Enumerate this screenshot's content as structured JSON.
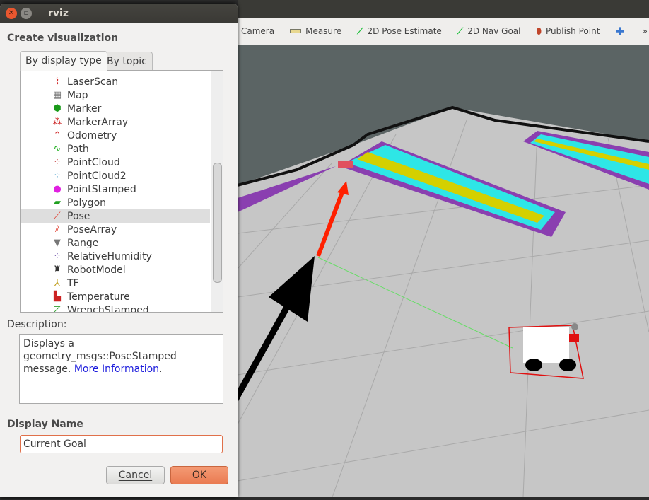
{
  "window": {
    "title": "rviz"
  },
  "toolbar": {
    "items": [
      {
        "label": "Camera",
        "icon": "camera-icon"
      },
      {
        "label": "Measure",
        "icon": "ruler-icon"
      },
      {
        "label": "2D Pose Estimate",
        "icon": "green-arrow-icon"
      },
      {
        "label": "2D Nav Goal",
        "icon": "green-arrow-icon"
      },
      {
        "label": "Publish Point",
        "icon": "map-pin-icon"
      },
      {
        "label": "",
        "icon": "plus-icon"
      }
    ],
    "overflow": "»"
  },
  "dialog": {
    "heading": "Create visualization",
    "tabs": [
      {
        "label": "By display type",
        "active": true
      },
      {
        "label": "By topic",
        "active": false
      }
    ],
    "items": [
      {
        "label": "LaserScan",
        "color": "#d02020",
        "glyph": "⌇"
      },
      {
        "label": "Map",
        "color": "#777777",
        "glyph": "▦"
      },
      {
        "label": "Marker",
        "color": "#1a9a1a",
        "glyph": "⬢"
      },
      {
        "label": "MarkerArray",
        "color": "#cc2222",
        "glyph": "⁂"
      },
      {
        "label": "Odometry",
        "color": "#d03030",
        "glyph": "⌃"
      },
      {
        "label": "Path",
        "color": "#20b020",
        "glyph": "∿"
      },
      {
        "label": "PointCloud",
        "color": "#c03030",
        "glyph": "⁘"
      },
      {
        "label": "PointCloud2",
        "color": "#3090c0",
        "glyph": "⁘"
      },
      {
        "label": "PointStamped",
        "color": "#e020e0",
        "glyph": "●"
      },
      {
        "label": "Polygon",
        "color": "#20a020",
        "glyph": "▰"
      },
      {
        "label": "Pose",
        "color": "#e03020",
        "glyph": "⟋",
        "selected": true
      },
      {
        "label": "PoseArray",
        "color": "#e03020",
        "glyph": "⫽"
      },
      {
        "label": "Range",
        "color": "#777777",
        "glyph": "▼"
      },
      {
        "label": "RelativeHumidity",
        "color": "#6040a0",
        "glyph": "⁘"
      },
      {
        "label": "RobotModel",
        "color": "#333333",
        "glyph": "♜"
      },
      {
        "label": "TF",
        "color": "#c0a020",
        "glyph": "⅄"
      },
      {
        "label": "Temperature",
        "color": "#cc2222",
        "glyph": "▙"
      },
      {
        "label": "WrenchStamped",
        "color": "#30a030",
        "glyph": "⦢"
      }
    ],
    "description_label": "Description:",
    "description_text": "Displays a geometry_msgs::PoseStamped message. ",
    "description_link": "More Information",
    "description_end": ".",
    "display_name_label": "Display Name",
    "display_name_value": "Current Goal",
    "cancel_label": "Cancel",
    "ok_label": "OK"
  },
  "colors": {
    "accent": "#ef8a62",
    "floor": "#c6c6c6",
    "unknown": "#5b6464",
    "costmap_cyan": "#2ee6e6",
    "costmap_yellow": "#d4d000",
    "costmap_purple": "#8a3fb0",
    "goal_arrow": "#ff2000"
  }
}
